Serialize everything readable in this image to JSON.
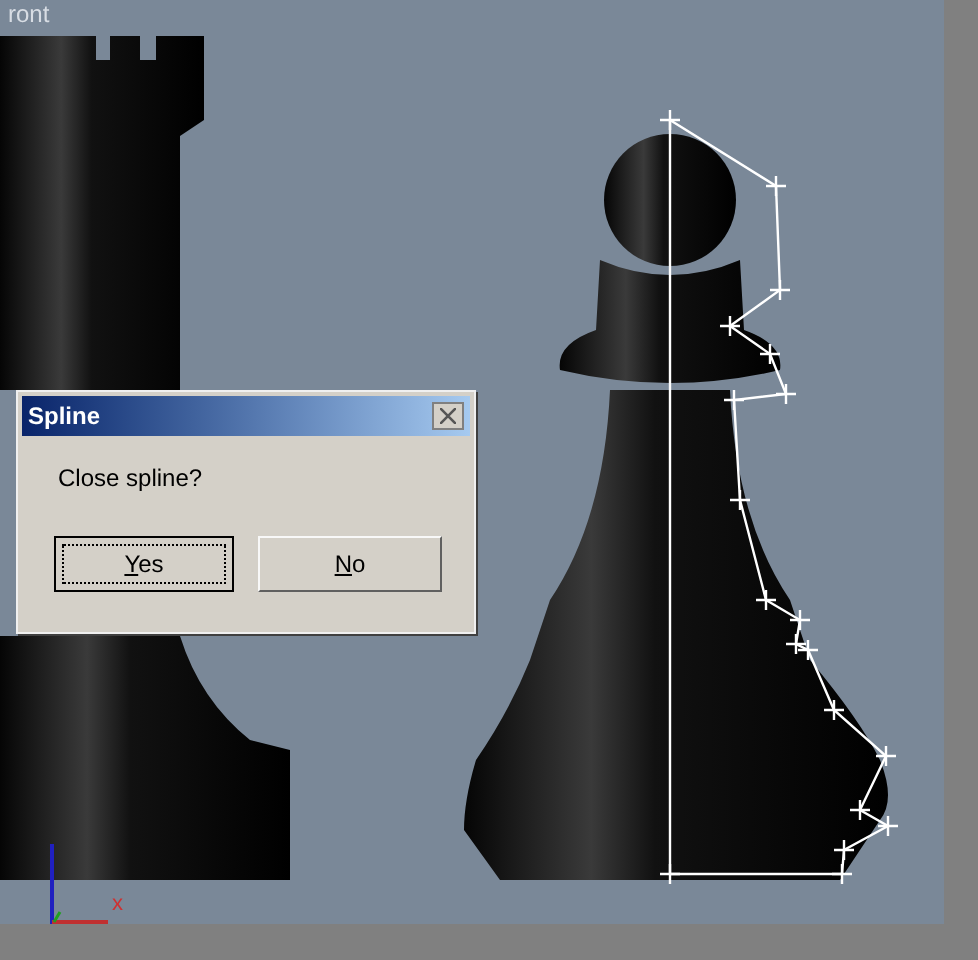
{
  "viewport": {
    "label": "ront",
    "axis_label": "x"
  },
  "dialog": {
    "title": "Spline",
    "message": "Close spline?",
    "buttons": [
      {
        "label": "Yes",
        "focused": true
      },
      {
        "label": "No",
        "focused": false
      }
    ]
  }
}
